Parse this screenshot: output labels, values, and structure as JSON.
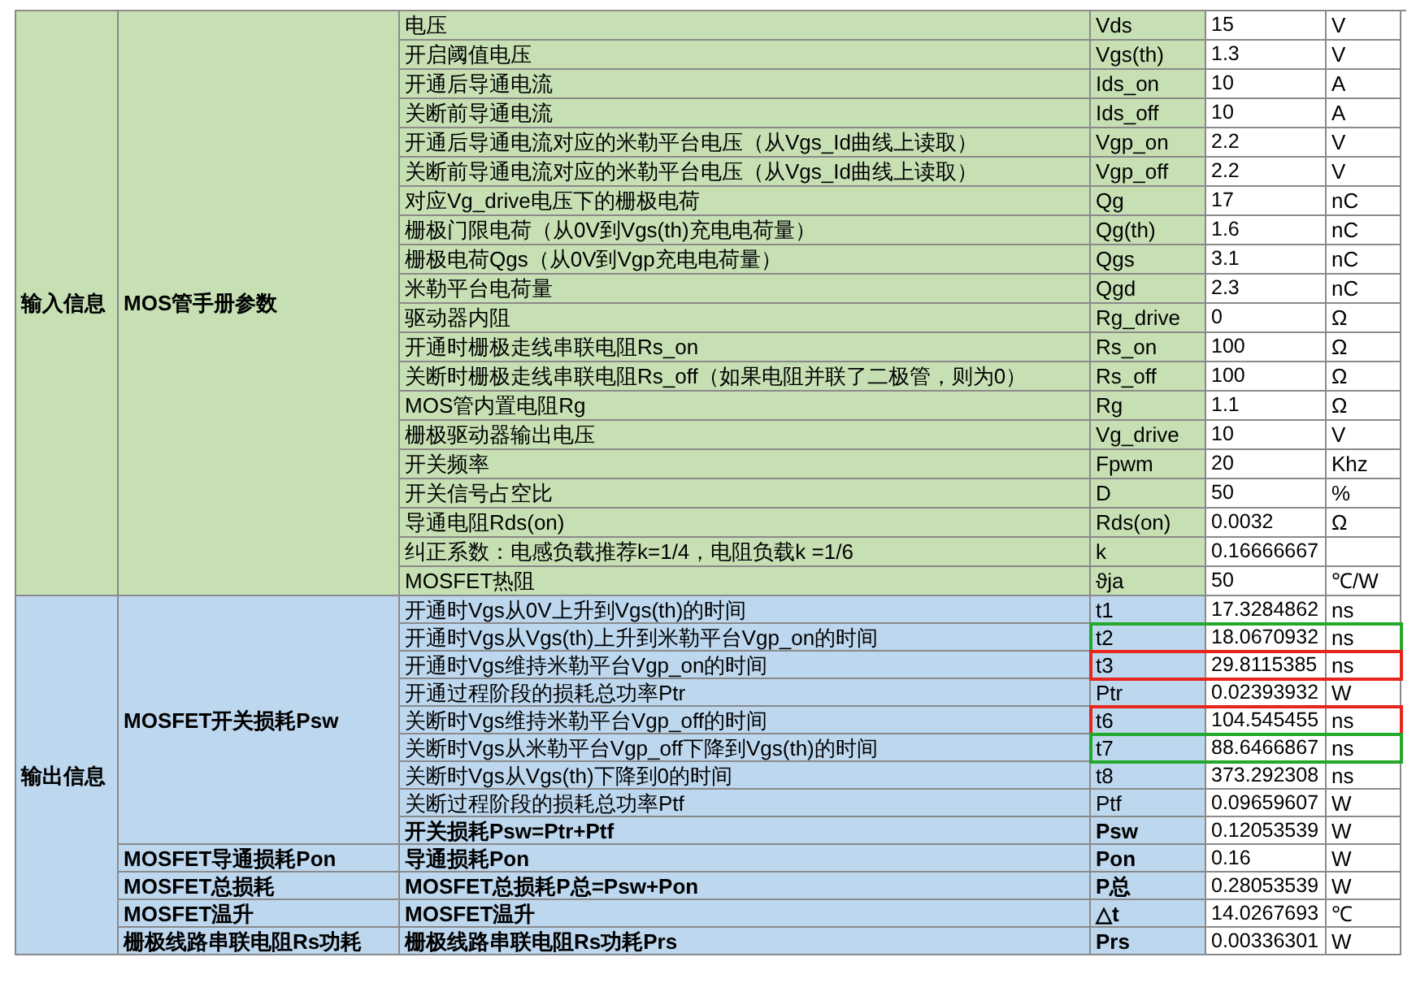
{
  "sections": [
    {
      "label": "输入信息",
      "kind": "input",
      "groups": [
        {
          "label": "MOS管手册参数",
          "rows": [
            {
              "description": "电压",
              "symbol": "Vds",
              "value": "15",
              "unit": "V"
            },
            {
              "description": "开启阈值电压",
              "symbol": "Vgs(th)",
              "value": "1.3",
              "unit": "V"
            },
            {
              "description": "开通后导通电流",
              "symbol": "Ids_on",
              "value": "10",
              "unit": "A"
            },
            {
              "description": "关断前导通电流",
              "symbol": "Ids_off",
              "value": "10",
              "unit": "A"
            },
            {
              "description": "开通后导通电流对应的米勒平台电压（从Vgs_Id曲线上读取）",
              "symbol": "Vgp_on",
              "value": "2.2",
              "unit": "V"
            },
            {
              "description": "关断前导通电流对应的米勒平台电压（从Vgs_Id曲线上读取）",
              "symbol": "Vgp_off",
              "value": "2.2",
              "unit": "V"
            },
            {
              "description": "对应Vg_drive电压下的栅极电荷",
              "symbol": "Qg",
              "value": "17",
              "unit": "nC"
            },
            {
              "description": "栅极门限电荷（从0V到Vgs(th)充电电荷量）",
              "symbol": "Qg(th)",
              "value": "1.6",
              "unit": "nC"
            },
            {
              "description": "栅极电荷Qgs（从0V到Vgp充电电荷量）",
              "symbol": "Qgs",
              "value": "3.1",
              "unit": "nC"
            },
            {
              "description": "米勒平台电荷量",
              "symbol": "Qgd",
              "value": "2.3",
              "unit": "nC"
            },
            {
              "description": "驱动器内阻",
              "symbol": "Rg_drive",
              "value": "0",
              "unit": "Ω"
            },
            {
              "description": "开通时栅极走线串联电阻Rs_on",
              "symbol": "Rs_on",
              "value": "100",
              "unit": "Ω"
            },
            {
              "description": "关断时栅极走线串联电阻Rs_off（如果电阻并联了二极管，则为0）",
              "symbol": "Rs_off",
              "value": "100",
              "unit": "Ω"
            },
            {
              "description": "MOS管内置电阻Rg",
              "symbol": "Rg",
              "value": "1.1",
              "unit": "Ω"
            },
            {
              "description": "栅极驱动器输出电压",
              "symbol": "Vg_drive",
              "value": "10",
              "unit": "V"
            },
            {
              "description": "开关频率",
              "symbol": "Fpwm",
              "value": "20",
              "unit": "Khz"
            },
            {
              "description": "开关信号占空比",
              "symbol": "D",
              "value": "50",
              "unit": "%"
            },
            {
              "description": "导通电阻Rds(on)",
              "symbol": "Rds(on)",
              "value": "0.0032",
              "unit": "Ω"
            },
            {
              "description": "纠正系数：电感负载推荐k=1/4，电阻负载k =1/6",
              "symbol": "k",
              "value": "0.16666667"
            },
            {
              "description": "MOSFET热阻",
              "symbol": "ϑja",
              "value": "50",
              "unit": "℃/W"
            }
          ]
        }
      ]
    },
    {
      "label": "输出信息",
      "kind": "output",
      "groups": [
        {
          "label": "MOSFET开关损耗Psw",
          "rows": [
            {
              "description": "开通时Vgs从0V上升到Vgs(th)的时间",
              "symbol": "t1",
              "value": "17.3284862",
              "unit": "ns"
            },
            {
              "description": "开通时Vgs从Vgs(th)上升到米勒平台Vgp_on的时间",
              "symbol": "t2",
              "value": "18.0670932",
              "unit": "ns",
              "color": "#22a82a"
            },
            {
              "description": "开通时Vgs维持米勒平台Vgp_on的时间",
              "symbol": "t3",
              "value": "29.8115385",
              "unit": "ns",
              "color": "#e8251c"
            },
            {
              "description": "开通过程阶段的损耗总功率Ptr",
              "symbol": "Ptr",
              "value": "0.02393932",
              "unit": "W"
            },
            {
              "description": "关断时Vgs维持米勒平台Vgp_off的时间",
              "symbol": "t6",
              "value": "104.545455",
              "unit": "ns",
              "color": "#e8251c"
            },
            {
              "description": "关断时Vgs从米勒平台Vgp_off下降到Vgs(th)的时间",
              "symbol": "t7",
              "value": "88.6466867",
              "unit": "ns",
              "color": "#22a82a"
            },
            {
              "description": "关断时Vgs从Vgs(th)下降到0的时间",
              "symbol": "t8",
              "value": "373.292308",
              "unit": "ns"
            },
            {
              "description": "关断过程阶段的损耗总功率Ptf",
              "symbol": "Ptf",
              "value": "0.09659607",
              "unit": "W"
            },
            {
              "description": "开关损耗Psw=Ptr+Ptf",
              "symbol": "Psw",
              "value": "0.12053539",
              "unit": "W",
              "bold": true
            }
          ]
        },
        {
          "label": "MOSFET导通损耗Pon",
          "rows": [
            {
              "description": "导通损耗Pon",
              "symbol": "Pon",
              "value": "0.16",
              "unit": "W",
              "bold": true
            }
          ]
        },
        {
          "label": "MOSFET总损耗",
          "rows": [
            {
              "description": "MOSFET总损耗P总=Psw+Pon",
              "symbol": "P总",
              "value": "0.28053539",
              "unit": "W",
              "bold": true
            }
          ]
        },
        {
          "label": "MOSFET温升",
          "rows": [
            {
              "description": "MOSFET温升",
              "symbol": "△t",
              "value": "14.0267693",
              "unit": "℃",
              "bold": true
            }
          ]
        },
        {
          "label": "栅极线路串联电阻Rs功耗",
          "rows": [
            {
              "description": "栅极线路串联电阻Rs功耗Prs",
              "symbol": "Prs",
              "value": "0.00336301",
              "unit": "W",
              "bold": true
            }
          ]
        }
      ]
    }
  ]
}
